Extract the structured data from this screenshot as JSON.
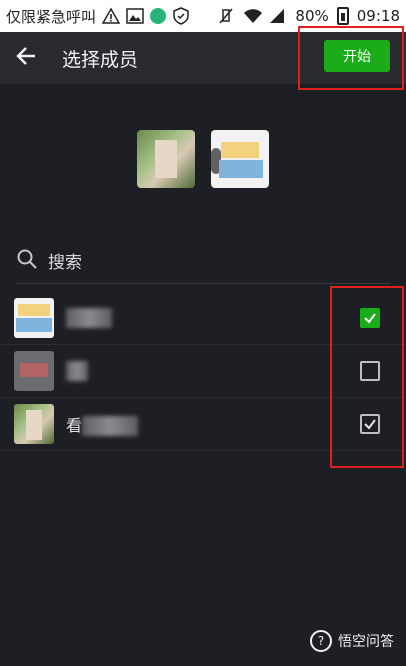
{
  "status_bar": {
    "carrier_text": "仅限紧急呼叫",
    "battery": "80%",
    "time": "09:18"
  },
  "header": {
    "title": "选择成员",
    "start_label": "开始"
  },
  "search": {
    "placeholder": "搜索"
  },
  "list": {
    "rows": [
      {
        "name": "",
        "checked": "green"
      },
      {
        "name": "",
        "checked": "empty"
      },
      {
        "name": "看",
        "checked": "check"
      }
    ]
  },
  "watermark": {
    "text": "悟空问答"
  },
  "colors": {
    "accent_green": "#1aad19",
    "background": "#1e1f24",
    "highlight_red": "#e02020"
  }
}
